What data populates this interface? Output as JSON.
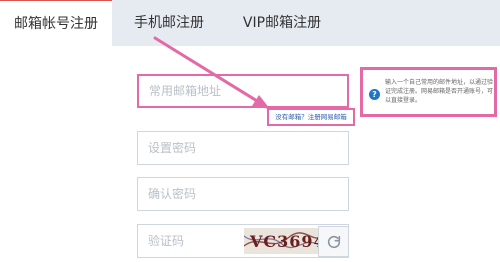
{
  "tabs": [
    {
      "label": "邮箱帐号注册"
    },
    {
      "label": "手机邮注册"
    },
    {
      "label": "VIP邮箱注册"
    }
  ],
  "form": {
    "email_placeholder": "常用邮箱地址",
    "email_link_text": "没有邮箱？注册网易邮箱",
    "password_placeholder": "设置密码",
    "confirm_placeholder": "确认密码",
    "captcha_placeholder": "验证码",
    "captcha_text": "VC3694"
  },
  "tooltip": {
    "text": "输入一个自己常用的邮件地址，以通过验证完成注册。网易邮箱是否开通账号，可以直接登录。"
  },
  "icons": {
    "info": "info-icon",
    "refresh": "refresh-icon"
  },
  "colors": {
    "accent_red": "#d9534f",
    "annotation_pink": "#e36aa6",
    "link_blue": "#2a5db0",
    "info_blue": "#1f75c6"
  }
}
